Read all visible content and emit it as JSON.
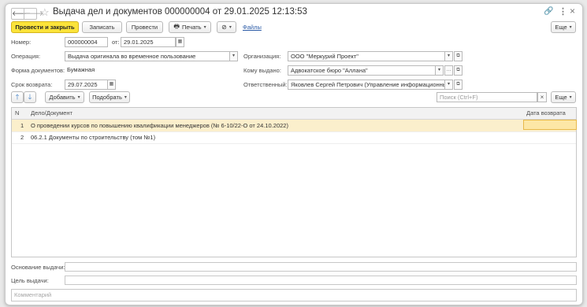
{
  "window": {
    "title": "Выдача дел и документов 000000004 от 29.01.2025 12:13:53"
  },
  "toolbar": {
    "post_close": "Провести и закрыть",
    "save": "Записать",
    "post": "Провести",
    "print": "Печать",
    "files": "Файлы",
    "more": "Еще"
  },
  "form": {
    "number_label": "Номер:",
    "number_value": "000000004",
    "date_label": "от:",
    "date_value": "29.01.2025",
    "operation_label": "Операция:",
    "operation_value": "Выдача оригинала во временное пользование",
    "organization_label": "Организация:",
    "organization_value": "ООО \"Меркурий Проект\"",
    "docform_label": "Форма документов:",
    "docform_value": "Бумажная",
    "issued_to_label": "Кому выдано:",
    "issued_to_value": "Адвокатское бюро \"Аллана\"",
    "return_label": "Срок возврата:",
    "return_value": "29.07.2025",
    "responsible_label": "Ответственный:",
    "responsible_value": "Яковлев Сергей Петрович (Управление информационных т"
  },
  "table_toolbar": {
    "add": "Добавить",
    "pick": "Подобрать",
    "search_placeholder": "Поиск (Ctrl+F)",
    "clear": "×",
    "more": "Еще"
  },
  "table": {
    "columns": [
      "N",
      "Дело/Документ",
      "Дата возврата"
    ],
    "rows": [
      {
        "n": "1",
        "doc": "О проведении курсов по повышению квалификации менеджеров (№ 6-10/22-О от 24.10.2022)",
        "date": ""
      },
      {
        "n": "2",
        "doc": "06.2.1 Документы по строительству (том №1)",
        "date": ""
      }
    ]
  },
  "footer": {
    "basis_label": "Основание выдачи:",
    "basis_value": "",
    "purpose_label": "Цель выдачи:",
    "purpose_value": "",
    "comment_placeholder": "Комментарий"
  }
}
